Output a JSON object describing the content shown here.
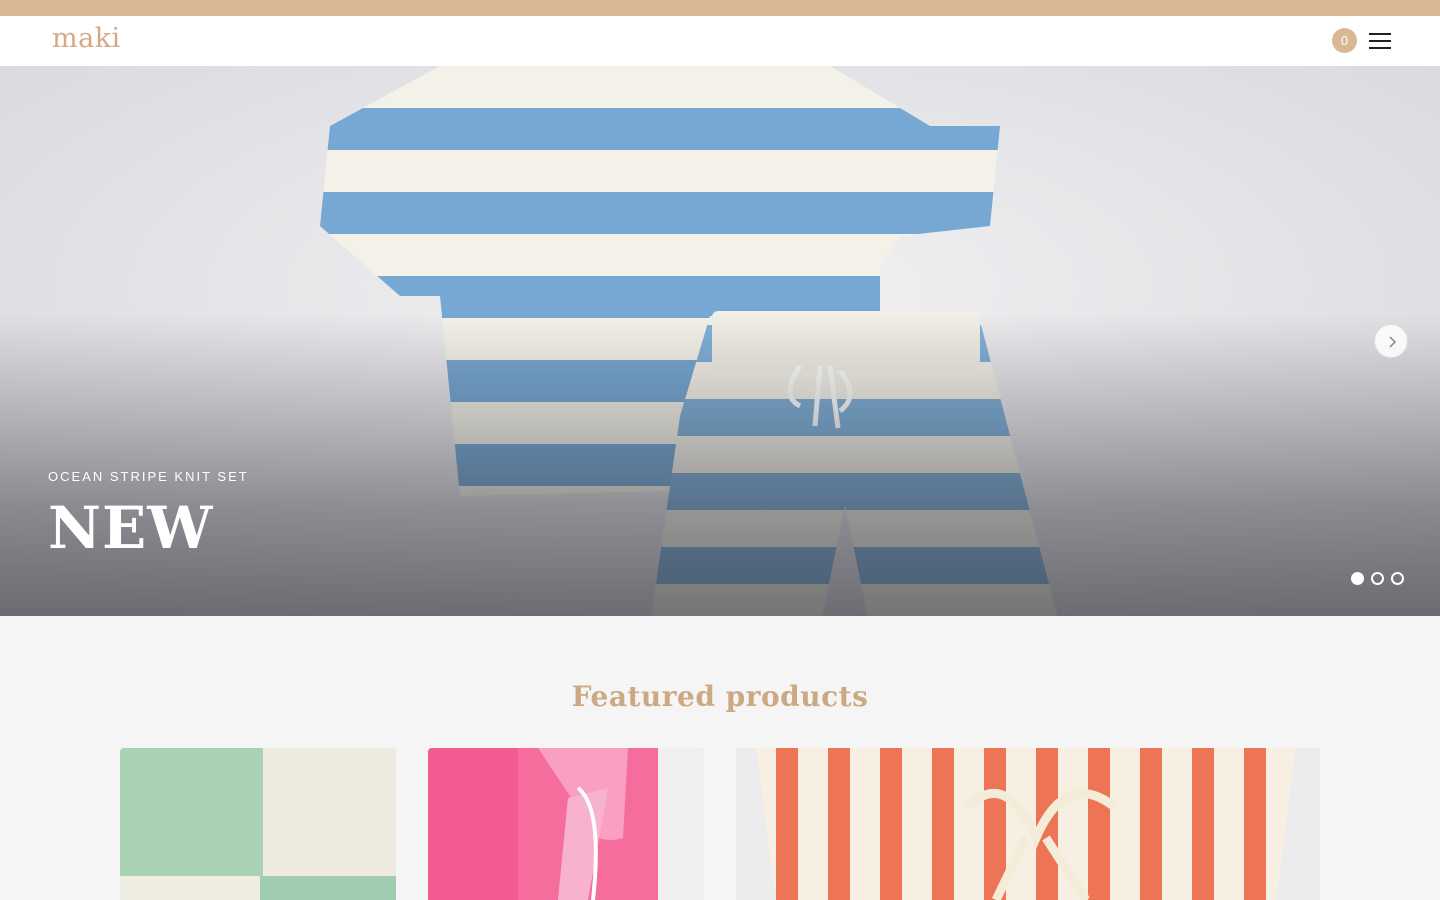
{
  "brand": {
    "logo_text": "maki",
    "accent_color": "#d9b994"
  },
  "header": {
    "cart_count": "0",
    "cart_icon": "cart-badge",
    "menu_icon": "hamburger-menu-icon"
  },
  "hero": {
    "subtitle": "OCEAN STRIPE KNIT SET",
    "title": "NEW",
    "next_icon": "chevron-right-icon",
    "slides_total": 3,
    "active_slide": 1
  },
  "featured": {
    "title": "Featured products",
    "products": [
      {
        "image": "mint-cream-knit"
      },
      {
        "image": "pink-tie-dye-shorts"
      },
      {
        "image": "red-stripe-knit-shorts"
      }
    ]
  }
}
